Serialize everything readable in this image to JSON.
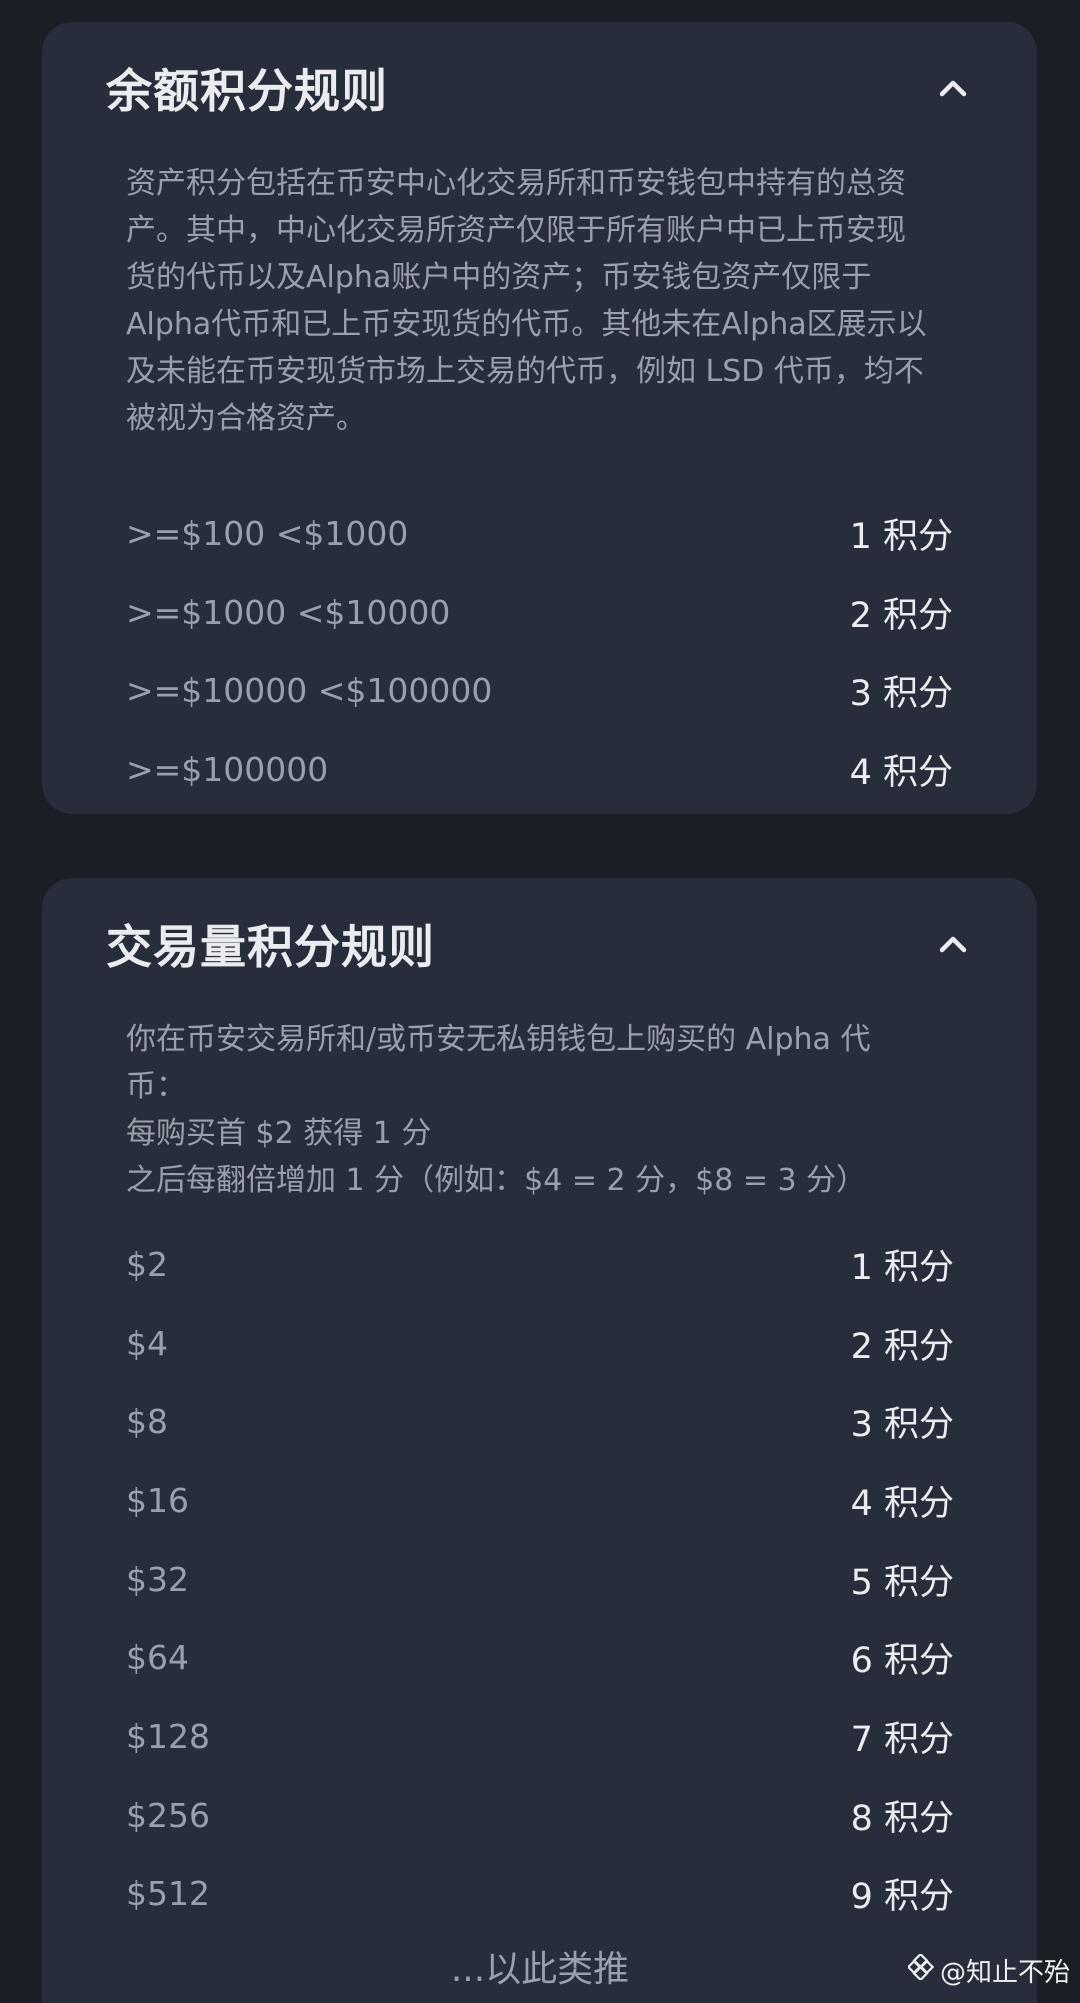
{
  "balance_card": {
    "title": "余额积分规则",
    "description": "资产积分包括在币安中心化交易所和币安钱包中持有的总资\n产。其中，中心化交易所资产仅限于所有账户中已上币安现\n货的代币以及Alpha账户中的资产；币安钱包资产仅限于\nAlpha代币和已上币安现货的代币。其他未在Alpha区展示以\n及未能在币安现货市场上交易的代币，例如 LSD 代币，均不\n被视为合格资产。",
    "rows": [
      {
        "label": ">=$100 <$1000",
        "value": "1 积分"
      },
      {
        "label": ">=$1000 <$10000",
        "value": "2 积分"
      },
      {
        "label": ">=$10000 <$100000",
        "value": "3 积分"
      },
      {
        "label": ">=$100000",
        "value": "4 积分"
      }
    ]
  },
  "volume_card": {
    "title": "交易量积分规则",
    "description": "你在币安交易所和/或币安无私钥钱包上购买的 Alpha 代\n币：\n每购买首 $2 获得 1 分\n之后每翻倍增加 1 分（例如：$4 = 2 分，$8 = 3 分）",
    "rows": [
      {
        "label": "$2",
        "value": "1 积分"
      },
      {
        "label": "$4",
        "value": "2 积分"
      },
      {
        "label": "$8",
        "value": "3 积分"
      },
      {
        "label": "$16",
        "value": "4 积分"
      },
      {
        "label": "$32",
        "value": "5 积分"
      },
      {
        "label": "$64",
        "value": "6 积分"
      },
      {
        "label": "$128",
        "value": "7 积分"
      },
      {
        "label": "$256",
        "value": "8 积分"
      },
      {
        "label": "$512",
        "value": "9 积分"
      }
    ],
    "more": "...以此类推"
  },
  "watermark": {
    "text": "@知止不殆",
    "icon": "diamond-logo-icon"
  }
}
